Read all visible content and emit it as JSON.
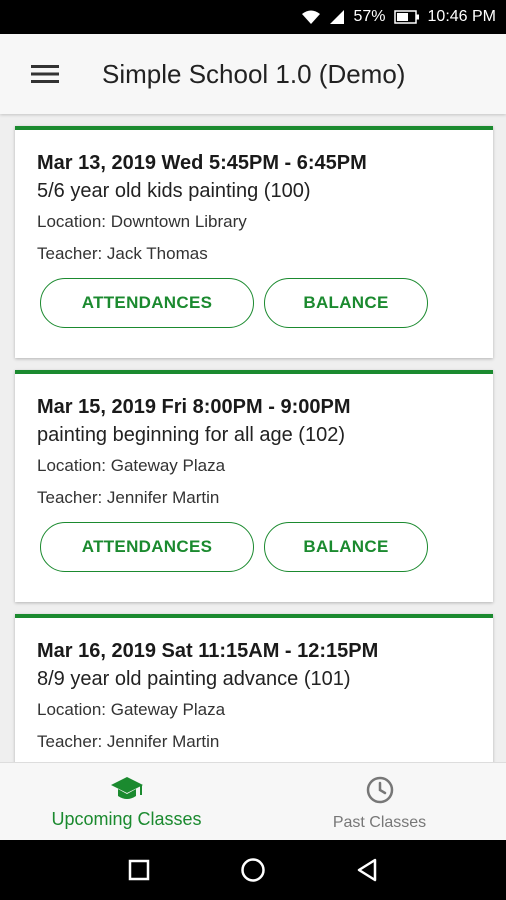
{
  "status_bar": {
    "battery": "57%",
    "time": "10:46 PM"
  },
  "app_bar": {
    "title": "Simple School 1.0 (Demo)"
  },
  "classes": [
    {
      "datetime": "Mar 13, 2019 Wed 5:45PM - 6:45PM",
      "course": "5/6 year old kids painting (100)",
      "location": "Location: Downtown Library",
      "teacher": "Teacher: Jack Thomas",
      "attendances_label": "ATTENDANCES",
      "balance_label": "BALANCE"
    },
    {
      "datetime": "Mar 15, 2019 Fri 8:00PM - 9:00PM",
      "course": "painting beginning for all age (102)",
      "location": "Location: Gateway Plaza",
      "teacher": "Teacher: Jennifer Martin",
      "attendances_label": "ATTENDANCES",
      "balance_label": "BALANCE"
    },
    {
      "datetime": "Mar 16, 2019 Sat 11:15AM - 12:15PM",
      "course": "8/9 year old painting advance (101)",
      "location": "Location: Gateway Plaza",
      "teacher": "Teacher: Jennifer Martin"
    }
  ],
  "bottom_nav": {
    "upcoming": {
      "label": "Upcoming Classes",
      "icon": "graduation-cap-icon",
      "active": true
    },
    "past": {
      "label": "Past Classes",
      "icon": "clock-icon",
      "active": false
    }
  },
  "colors": {
    "accent": "#1b8a2f",
    "inactive": "#777777"
  }
}
